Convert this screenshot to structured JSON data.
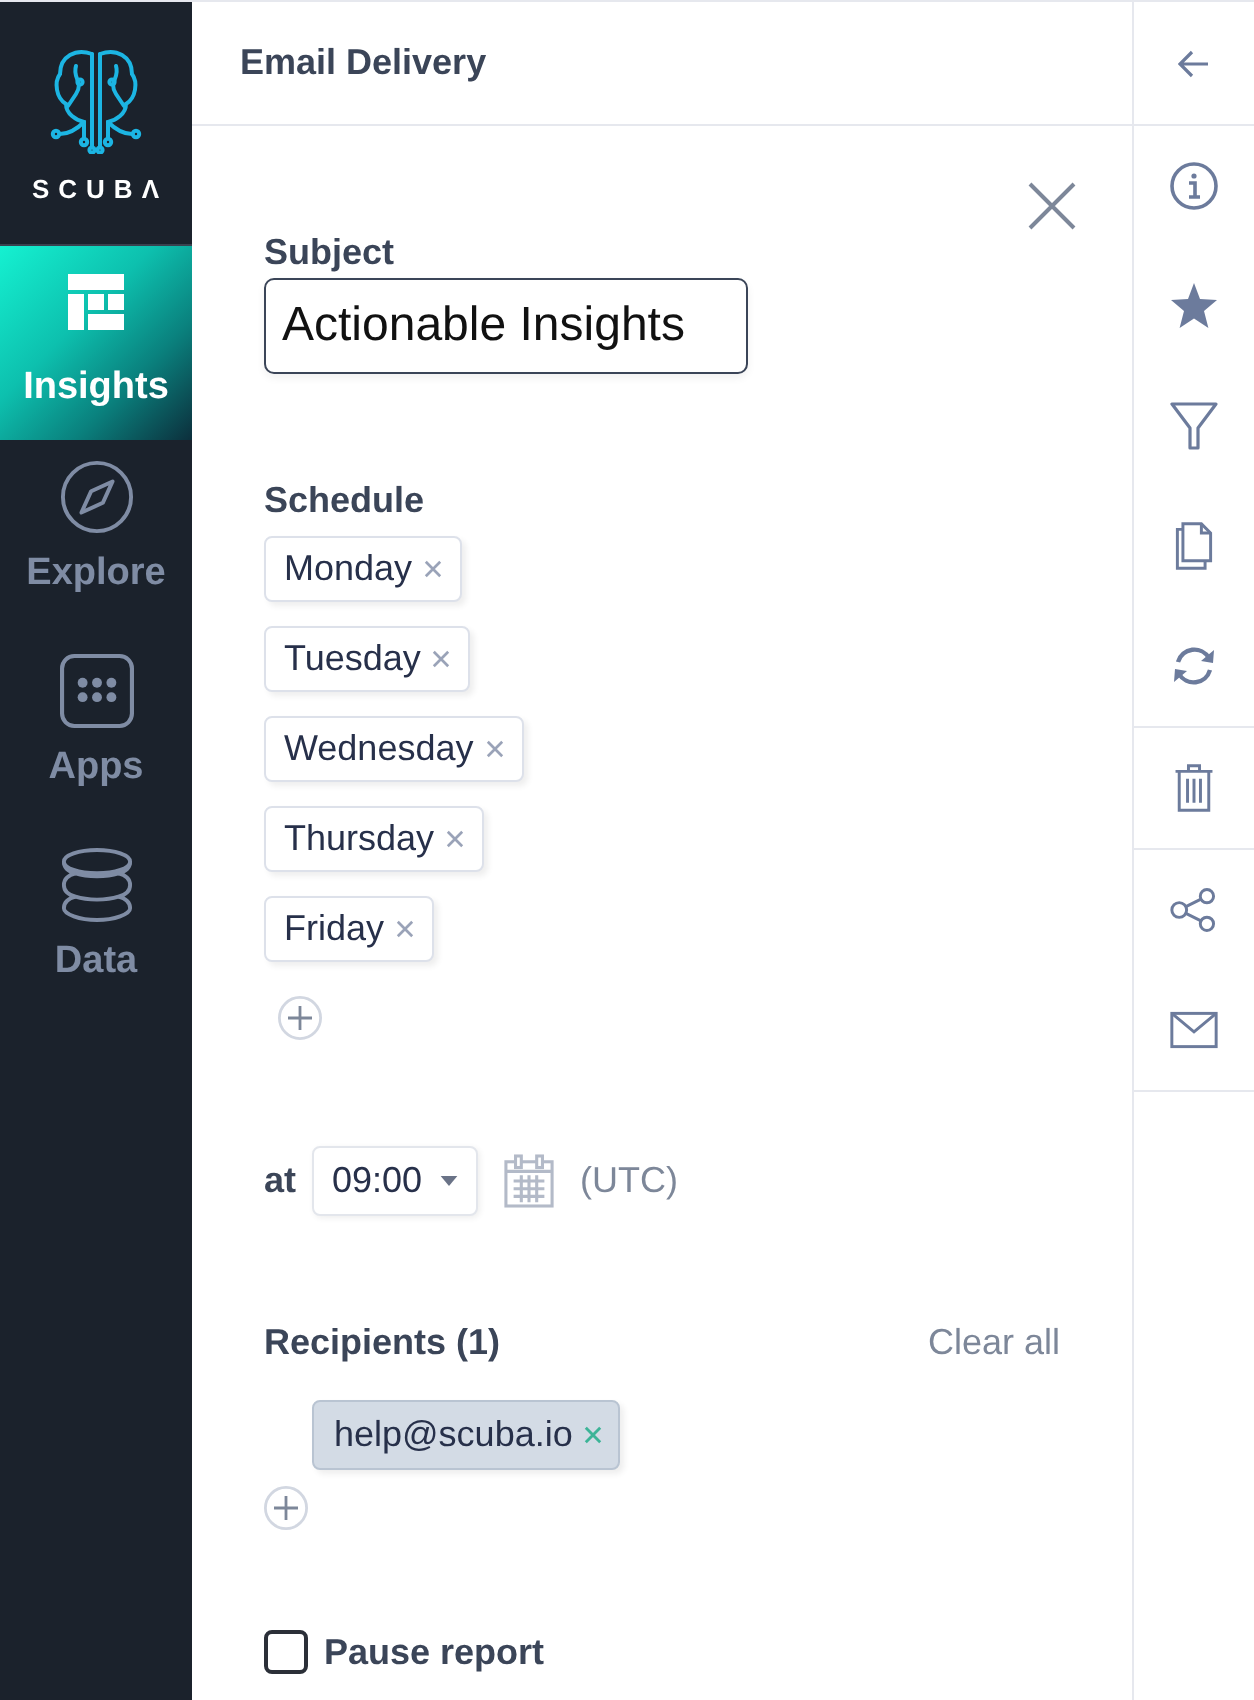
{
  "sidebar": {
    "logo_text": "SCUBΛ",
    "items": [
      {
        "label": "Insights",
        "selected": true
      },
      {
        "label": "Explore",
        "selected": false
      },
      {
        "label": "Apps",
        "selected": false
      },
      {
        "label": "Data",
        "selected": false
      }
    ]
  },
  "panel": {
    "title": "Email Delivery"
  },
  "form": {
    "subject": {
      "label": "Subject",
      "value": "Actionable Insights"
    },
    "schedule": {
      "label": "Schedule",
      "days": [
        "Monday",
        "Tuesday",
        "Wednesday",
        "Thursday",
        "Friday"
      ]
    },
    "time": {
      "label": "at",
      "value": "09:00",
      "timezone": "(UTC)"
    },
    "recipients": {
      "label": "Recipients (1)",
      "clear_label": "Clear all",
      "emails": [
        "help@scuba.io"
      ]
    },
    "pause_report": {
      "label": "Pause report",
      "checked": false
    }
  }
}
